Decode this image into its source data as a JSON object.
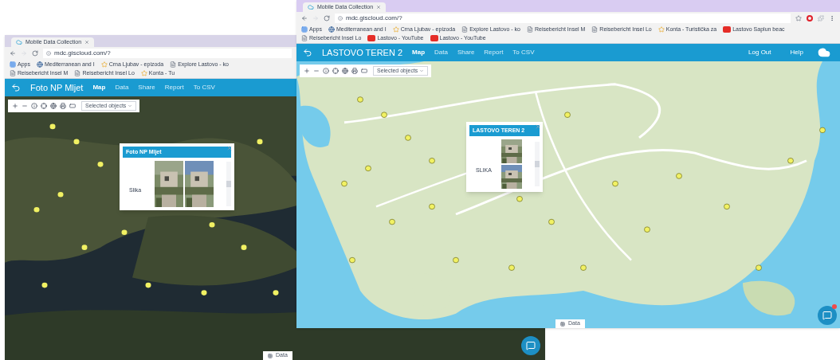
{
  "windows": [
    {
      "tab": {
        "title": "Mobile Data Collection"
      },
      "address": "mdc.giscloud.com/?",
      "bookmarks": [
        {
          "kind": "apps",
          "label": "Apps"
        },
        {
          "kind": "globe",
          "label": "Mediterranean and I"
        },
        {
          "kind": "tour",
          "label": "Crna Ljubav - epizoda"
        },
        {
          "kind": "page",
          "label": "Explore Lastovo - ko"
        },
        {
          "kind": "page",
          "label": "Reisebericht Insel M"
        },
        {
          "kind": "page",
          "label": "Reisebericht Insel Lo"
        },
        {
          "kind": "tour",
          "label": "Konta - Tu"
        }
      ],
      "app": {
        "title": "Foto NP Mljet",
        "nav": [
          {
            "label": "Map",
            "selected": true
          },
          {
            "label": "Data",
            "selected": false
          },
          {
            "label": "Share",
            "selected": false
          },
          {
            "label": "Report",
            "selected": false
          },
          {
            "label": "To CSV",
            "selected": false
          }
        ]
      },
      "toolbar": {
        "dropdown": "Selected objects"
      },
      "map": {
        "kind": "satellite"
      },
      "popup": {
        "title": "Foto NP Mljet",
        "field": "Slika",
        "kind": "side_by_side"
      },
      "data_button": "Data",
      "chat": {
        "badge": false
      }
    },
    {
      "tab": {
        "title": "Mobile Data Collection"
      },
      "address": "mdc.giscloud.com/?",
      "bookmarks": [
        {
          "kind": "apps",
          "label": "Apps"
        },
        {
          "kind": "globe",
          "label": "Mediterranean and I"
        },
        {
          "kind": "tour",
          "label": "Crna Ljubav - epizoda"
        },
        {
          "kind": "page",
          "label": "Explore Lastovo - ko"
        },
        {
          "kind": "page",
          "label": "Reisebericht Insel M"
        },
        {
          "kind": "page",
          "label": "Reisebericht Insel Lo"
        },
        {
          "kind": "tour",
          "label": "Konta - Turistička za"
        },
        {
          "kind": "youtube",
          "label": "Lastovo Saplun beac"
        },
        {
          "kind": "page",
          "label": "Reisebericht Insel Lo"
        },
        {
          "kind": "youtube",
          "label": "Lastovo - YouTube"
        },
        {
          "kind": "youtube",
          "label": "Lastovo - YouTube"
        }
      ],
      "app": {
        "title": "LASTOVO TEREN 2",
        "nav": [
          {
            "label": "Map",
            "selected": true
          },
          {
            "label": "Data",
            "selected": false
          },
          {
            "label": "Share",
            "selected": false
          },
          {
            "label": "Report",
            "selected": false
          },
          {
            "label": "To CSV",
            "selected": false
          }
        ],
        "right_nav": [
          "Log Out",
          "Help"
        ]
      },
      "toolbar": {
        "dropdown": "Selected objects"
      },
      "map": {
        "kind": "street"
      },
      "popup": {
        "title": "LASTOVO TEREN 2",
        "field": "SLIKA",
        "kind": "stacked"
      },
      "data_button": "Data",
      "chat": {
        "badge": true
      }
    }
  ]
}
